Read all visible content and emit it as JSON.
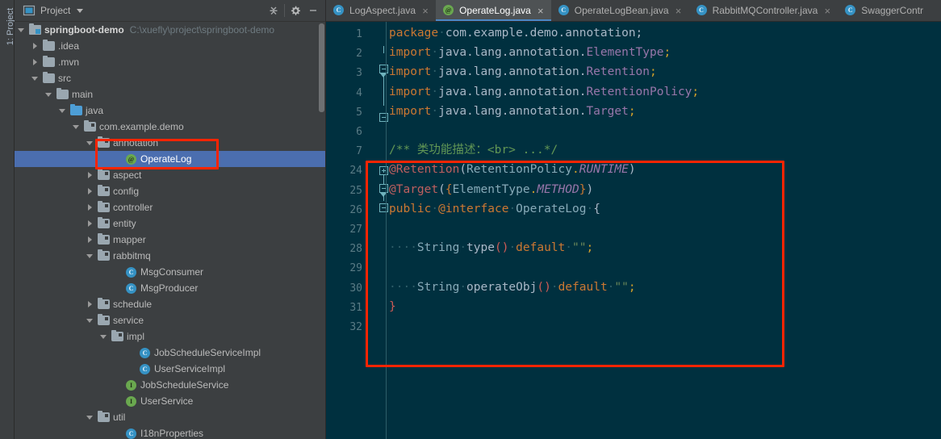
{
  "toolstrip": {
    "label": "1: Project"
  },
  "project_panel": {
    "header": {
      "icon": "project-window-icon",
      "title": "Project",
      "caret": "chevron-down-icon",
      "collapse_all_icon": "collapse-all-icon",
      "settings_icon": "gear-icon",
      "hide_icon": "minimize-icon"
    },
    "tree": [
      {
        "label": "springboot-demo",
        "path": "C:\\xuefly\\project\\springboot-demo",
        "depth": 0,
        "arrow": "down",
        "icon": "module-icon",
        "bold": true
      },
      {
        "label": ".idea",
        "depth": 1,
        "arrow": "right",
        "icon": "folder-icon"
      },
      {
        "label": ".mvn",
        "depth": 1,
        "arrow": "right",
        "icon": "folder-icon"
      },
      {
        "label": "src",
        "depth": 1,
        "arrow": "down",
        "icon": "folder-icon"
      },
      {
        "label": "main",
        "depth": 2,
        "arrow": "down",
        "icon": "folder-icon"
      },
      {
        "label": "java",
        "depth": 3,
        "arrow": "down",
        "icon": "source-folder-icon"
      },
      {
        "label": "com.example.demo",
        "depth": 4,
        "arrow": "down",
        "icon": "package-icon"
      },
      {
        "label": "annotation",
        "depth": 5,
        "arrow": "down",
        "icon": "package-icon"
      },
      {
        "label": "OperateLog",
        "depth": 7,
        "arrow": "none",
        "icon": "annotation-type-icon",
        "selected": true
      },
      {
        "label": "aspect",
        "depth": 5,
        "arrow": "right",
        "icon": "package-icon"
      },
      {
        "label": "config",
        "depth": 5,
        "arrow": "right",
        "icon": "package-icon"
      },
      {
        "label": "controller",
        "depth": 5,
        "arrow": "right",
        "icon": "package-icon"
      },
      {
        "label": "entity",
        "depth": 5,
        "arrow": "right",
        "icon": "package-icon"
      },
      {
        "label": "mapper",
        "depth": 5,
        "arrow": "right",
        "icon": "package-icon"
      },
      {
        "label": "rabbitmq",
        "depth": 5,
        "arrow": "down",
        "icon": "package-icon"
      },
      {
        "label": "MsgConsumer",
        "depth": 7,
        "arrow": "none",
        "icon": "class-icon"
      },
      {
        "label": "MsgProducer",
        "depth": 7,
        "arrow": "none",
        "icon": "class-icon"
      },
      {
        "label": "schedule",
        "depth": 5,
        "arrow": "right",
        "icon": "package-icon"
      },
      {
        "label": "service",
        "depth": 5,
        "arrow": "down",
        "icon": "package-icon"
      },
      {
        "label": "impl",
        "depth": 6,
        "arrow": "down",
        "icon": "package-icon"
      },
      {
        "label": "JobScheduleServiceImpl",
        "depth": 8,
        "arrow": "none",
        "icon": "class-icon"
      },
      {
        "label": "UserServiceImpl",
        "depth": 8,
        "arrow": "none",
        "icon": "class-icon"
      },
      {
        "label": "JobScheduleService",
        "depth": 7,
        "arrow": "none",
        "icon": "interface-icon"
      },
      {
        "label": "UserService",
        "depth": 7,
        "arrow": "none",
        "icon": "interface-icon"
      },
      {
        "label": "util",
        "depth": 5,
        "arrow": "down",
        "icon": "package-icon"
      },
      {
        "label": "I18nProperties",
        "depth": 7,
        "arrow": "none",
        "icon": "class-icon"
      }
    ]
  },
  "editor": {
    "tabs": [
      {
        "label": "LogAspect.java",
        "icon": "class-icon",
        "active": false,
        "closable": true
      },
      {
        "label": "OperateLog.java",
        "icon": "annotation-type-icon",
        "active": true,
        "closable": true
      },
      {
        "label": "OperateLogBean.java",
        "icon": "class-icon",
        "active": false,
        "closable": true
      },
      {
        "label": "RabbitMQController.java",
        "icon": "class-icon",
        "active": false,
        "closable": true
      },
      {
        "label": "SwaggerContr",
        "icon": "class-icon",
        "active": false,
        "closable": false
      }
    ],
    "line_numbers": [
      "1",
      "2",
      "3",
      "4",
      "5",
      "6",
      "7",
      "24",
      "25",
      "26",
      "27",
      "28",
      "29",
      "30",
      "31",
      "32"
    ],
    "lines": [
      {
        "n": "1",
        "text": "package com.example.demo.annotation;"
      },
      {
        "n": "2",
        "text": "import java.lang.annotation.ElementType;"
      },
      {
        "n": "3",
        "text": "import java.lang.annotation.Retention;"
      },
      {
        "n": "4",
        "text": "import java.lang.annotation.RetentionPolicy;"
      },
      {
        "n": "5",
        "text": "import java.lang.annotation.Target;"
      },
      {
        "n": "6",
        "text": ""
      },
      {
        "n": "7",
        "text": "/** 类功能描述：<br> ...*/"
      },
      {
        "n": "24",
        "text": "@Retention(RetentionPolicy.RUNTIME)"
      },
      {
        "n": "25",
        "text": "@Target({ElementType.METHOD})"
      },
      {
        "n": "26",
        "text": "public @interface OperateLog {"
      },
      {
        "n": "27",
        "text": ""
      },
      {
        "n": "28",
        "text": "    String type() default \"\";"
      },
      {
        "n": "29",
        "text": ""
      },
      {
        "n": "30",
        "text": "    String operateObj() default \"\";"
      },
      {
        "n": "31",
        "text": "}"
      },
      {
        "n": "32",
        "text": ""
      }
    ],
    "tokens": {
      "l1": [
        [
          "k",
          "package"
        ],
        [
          "ws",
          "·"
        ],
        [
          "id",
          "com.example.demo.annotation"
        ],
        [
          "id",
          ";"
        ]
      ],
      "l2": [
        [
          "k",
          "import"
        ],
        [
          "ws",
          "·"
        ],
        [
          "id",
          "java.lang.annotation."
        ],
        [
          "pk",
          "ElementType"
        ],
        [
          "yel",
          ";"
        ]
      ],
      "l3": [
        [
          "k",
          "import"
        ],
        [
          "ws",
          "·"
        ],
        [
          "id",
          "java.lang.annotation."
        ],
        [
          "pk",
          "Retention"
        ],
        [
          "yel",
          ";"
        ]
      ],
      "l4": [
        [
          "k",
          "import"
        ],
        [
          "ws",
          "·"
        ],
        [
          "id",
          "java.lang.annotation."
        ],
        [
          "pk",
          "RetentionPolicy"
        ],
        [
          "yel",
          ";"
        ]
      ],
      "l5": [
        [
          "k",
          "import"
        ],
        [
          "ws",
          "·"
        ],
        [
          "id",
          "java.lang.annotation."
        ],
        [
          "pk",
          "Target"
        ],
        [
          "yel",
          ";"
        ]
      ],
      "l7": [
        [
          "docc",
          "/** 类功能描述：<br> ...*/"
        ]
      ],
      "l24": [
        [
          "annr",
          "@Retention"
        ],
        [
          "par",
          "("
        ],
        [
          "tealid",
          "RetentionPolicy"
        ],
        [
          "yel",
          "."
        ],
        [
          "sta",
          "RUNTIME"
        ],
        [
          "par",
          ")"
        ]
      ],
      "l25": [
        [
          "annr",
          "@Target"
        ],
        [
          "par",
          "("
        ],
        [
          "brc",
          "{"
        ],
        [
          "tealid",
          "ElementType"
        ],
        [
          "yel",
          "."
        ],
        [
          "sta",
          "METHOD"
        ],
        [
          "brc",
          "}"
        ],
        [
          "par",
          ")"
        ]
      ],
      "l26": [
        [
          "k",
          "public"
        ],
        [
          "ws",
          "·"
        ],
        [
          "k",
          "@interface"
        ],
        [
          "ws",
          "·"
        ],
        [
          "tealid",
          "OperateLog"
        ],
        [
          "ws",
          "·"
        ],
        [
          "id",
          "{"
        ]
      ],
      "l28": [
        [
          "ws",
          "····"
        ],
        [
          "tealid",
          "String"
        ],
        [
          "ws",
          "·"
        ],
        [
          "id",
          "type"
        ],
        [
          "red",
          "()"
        ],
        [
          "ws",
          "·"
        ],
        [
          "k",
          "default"
        ],
        [
          "ws",
          "·"
        ],
        [
          "str",
          "\"\""
        ],
        [
          "yel",
          ";"
        ]
      ],
      "l30": [
        [
          "ws",
          "····"
        ],
        [
          "tealid",
          "String"
        ],
        [
          "ws",
          "·"
        ],
        [
          "id",
          "operateObj"
        ],
        [
          "red",
          "()"
        ],
        [
          "ws",
          "·"
        ],
        [
          "k",
          "default"
        ],
        [
          "ws",
          "·"
        ],
        [
          "str",
          "\"\""
        ],
        [
          "yel",
          ";"
        ]
      ],
      "l31": [
        [
          "red",
          "}"
        ]
      ]
    }
  },
  "colors": {
    "panel_bg": "#3c3f41",
    "editor_bg": "#00303f",
    "selection_blue": "#4b6eaf",
    "tab_active_bg": "#4e5254",
    "tab_underline": "#4a88c7",
    "annotation_red": "#ff2400",
    "indent_guide": "#2e5d68",
    "keyword_orange": "#cc7832",
    "line_number": "#5a7b85"
  }
}
